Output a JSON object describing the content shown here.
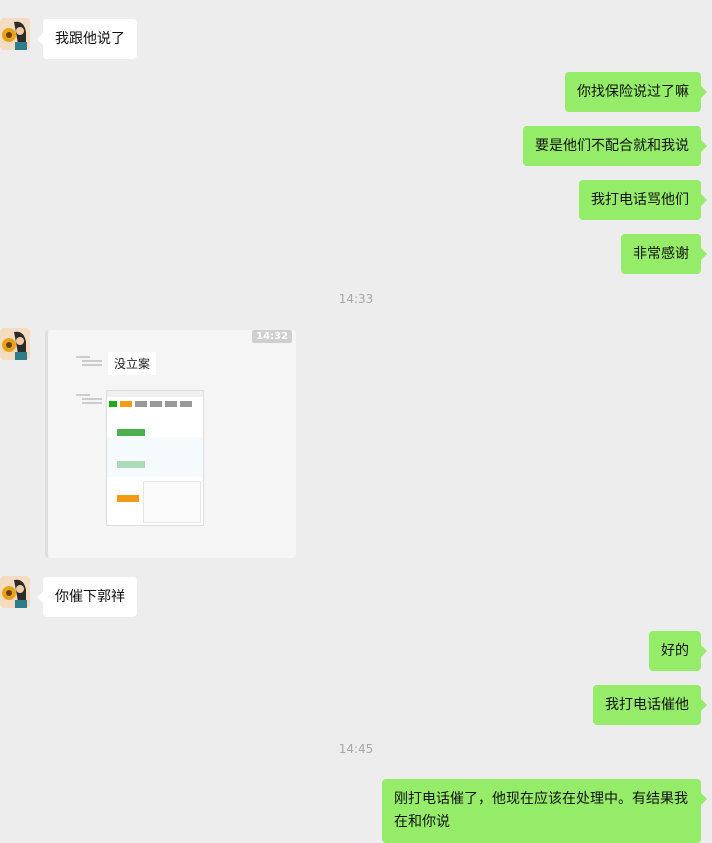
{
  "messages": {
    "m1": "我跟他说了",
    "m2": "你找保险说过了嘛",
    "m3": "要是他们不配合就和我说",
    "m4": "我打电话骂他们",
    "m5": "非常感谢",
    "m6": "你催下郭祥",
    "m7": "好的",
    "m8": "我打电话催他",
    "m9": "刚打电话催了，他现在应该在处理中。有结果我在和你说"
  },
  "timestamps": {
    "t1": "14:33",
    "t2": "14:45"
  },
  "screenshot_image": {
    "time": "14:32",
    "inner_bubble": "没立案"
  },
  "colors": {
    "bg": "#ededed",
    "sent_bubble": "#95ec69",
    "received_bubble": "#ffffff"
  }
}
